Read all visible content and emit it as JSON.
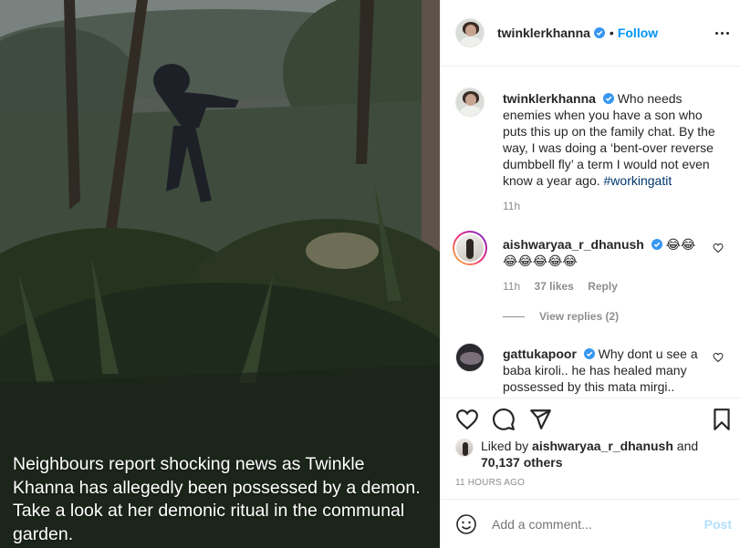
{
  "post": {
    "caption_overlay": "Neighbours report shocking news as Twinkle Khanna has allegedly been possessed by a demon. Take a look at her demonic ritual in the communal garden."
  },
  "header": {
    "username": "twinklerkhanna",
    "dot": "•",
    "follow_label": "Follow"
  },
  "caption_comment": {
    "username": "twinklerkhanna",
    "text": "Who needs enemies when you have a son who puts this up on the family chat. By the way, I was doing a ‘bent-over reverse dumbbell fly’ a term I would not even know a year ago.",
    "hashtag": "#workingatit",
    "time": "11h"
  },
  "comments": [
    {
      "username": "aishwaryaa_r_dhanush",
      "text": "😂😂 😂😂😂😂😂",
      "time": "11h",
      "likes": "37 likes",
      "reply_label": "Reply",
      "view_replies": "View replies (2)"
    },
    {
      "username": "gattukapoor",
      "text": "Why dont u see a baba kiroli.. he has healed many possessed by this mata mirgi.."
    }
  ],
  "likes": {
    "prefix": "Liked by",
    "user": "aishwaryaa_r_dhanush",
    "and": "and",
    "others": "70,137 others"
  },
  "timestamp": "11 HOURS AGO",
  "add_comment": {
    "placeholder": "Add a comment...",
    "post_label": "Post"
  },
  "colors": {
    "accent": "#0095f6",
    "verified": "#3897f0",
    "muted": "#8e8e8e",
    "post_disabled": "#b2dffc"
  },
  "icons": [
    "more-options-icon",
    "verified-badge-icon",
    "heart-icon",
    "comment-icon",
    "share-icon",
    "bookmark-icon",
    "emoji-icon"
  ]
}
